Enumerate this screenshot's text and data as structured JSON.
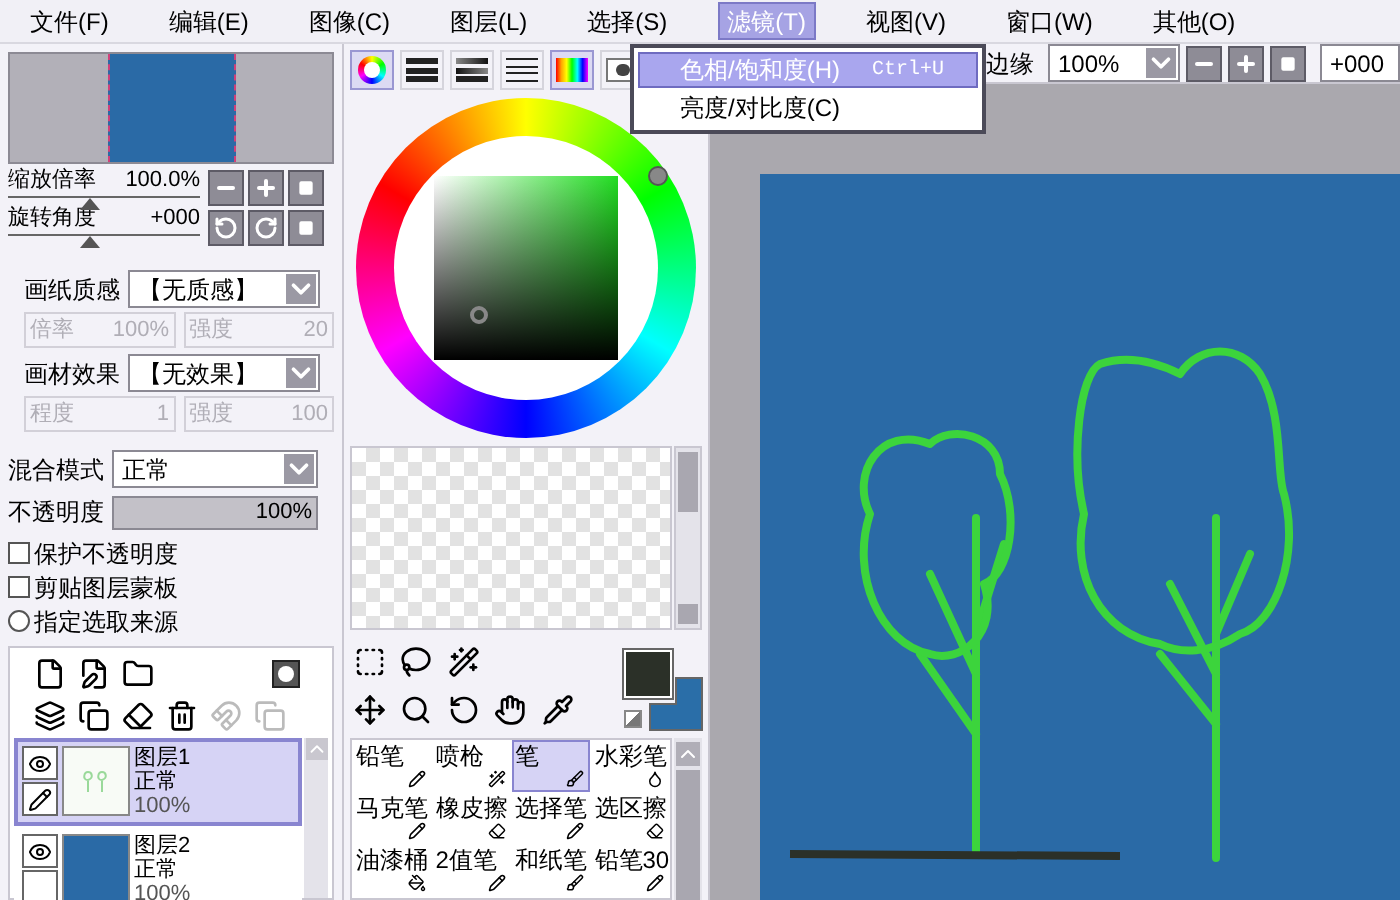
{
  "menu": [
    {
      "label": "文件(F)",
      "selected": false
    },
    {
      "label": "编辑(E)",
      "selected": false
    },
    {
      "label": "图像(C)",
      "selected": false
    },
    {
      "label": "图层(L)",
      "selected": false
    },
    {
      "label": "选择(S)",
      "selected": false
    },
    {
      "label": "滤镜(T)",
      "selected": true
    },
    {
      "label": "视图(V)",
      "selected": false
    },
    {
      "label": "窗口(W)",
      "selected": false
    },
    {
      "label": "其他(O)",
      "selected": false
    }
  ],
  "filter_menu": [
    {
      "label": "色相/饱和度(H)",
      "shortcut": "Ctrl+U",
      "selected": true
    },
    {
      "label": "亮度/对比度(C)",
      "selected": false
    }
  ],
  "toolbar": {
    "edge_label": "边缘",
    "zoom": "100%",
    "rotation": "+000"
  },
  "navigator": {
    "sliders": [
      {
        "label": "缩放倍率",
        "value": "100.0%",
        "level": 0.42
      },
      {
        "label": "旋转角度",
        "value": "+000",
        "level": 0.42
      }
    ]
  },
  "texture": [
    {
      "label": "画纸质感",
      "value": "【无质感】",
      "fields": [
        {
          "label": "倍率",
          "value": "100%",
          "disabled": true
        },
        {
          "label": "强度",
          "value": "20",
          "disabled": true
        }
      ]
    },
    {
      "label": "画材效果",
      "value": "【无效果】",
      "fields": [
        {
          "label": "程度",
          "value": "1",
          "disabled": true
        },
        {
          "label": "强度",
          "value": "100",
          "disabled": true
        }
      ]
    }
  ],
  "blend": {
    "label": "混合模式",
    "value": "正常"
  },
  "opacity": {
    "label": "不透明度",
    "value": "100%",
    "level": 1
  },
  "options": [
    {
      "kind": "checkbox",
      "label": "保护不透明度",
      "checked": false
    },
    {
      "kind": "checkbox",
      "label": "剪贴图层蒙板",
      "checked": false
    },
    {
      "kind": "radio",
      "label": "指定选取来源",
      "checked": false
    }
  ],
  "layers": [
    {
      "name": "图层1",
      "mode": "正常",
      "opacity": "100%",
      "selected": true,
      "visible": true,
      "editing": true,
      "kind": "sketch"
    },
    {
      "name": "图层2",
      "mode": "正常",
      "opacity": "100%",
      "selected": false,
      "visible": true,
      "editing": false,
      "kind": "fill"
    }
  ],
  "color_modes": [
    {
      "kind": "ring",
      "selected": true
    },
    {
      "kind": "bars",
      "selected": false
    },
    {
      "kind": "gradient_bars",
      "selected": false
    },
    {
      "kind": "lines",
      "selected": false
    },
    {
      "kind": "grid",
      "selected": true
    },
    {
      "kind": "blob",
      "selected": false
    }
  ],
  "swatches": [
    {
      "color": "#2b3028"
    },
    {
      "color": "#2a6ea8"
    }
  ],
  "brushes": [
    {
      "label": "铅笔",
      "selected": false
    },
    {
      "label": "喷枪",
      "selected": false
    },
    {
      "label": "笔",
      "selected": true
    },
    {
      "label": "水彩笔",
      "selected": false
    },
    {
      "label": "马克笔",
      "selected": false
    },
    {
      "label": "橡皮擦",
      "selected": false
    },
    {
      "label": "选择笔",
      "selected": false
    },
    {
      "label": "选区擦",
      "selected": false
    },
    {
      "label": "油漆桶",
      "selected": false
    },
    {
      "label": "2值笔",
      "selected": false
    },
    {
      "label": "和纸笔",
      "selected": false
    },
    {
      "label": "铅笔30",
      "selected": false
    }
  ]
}
